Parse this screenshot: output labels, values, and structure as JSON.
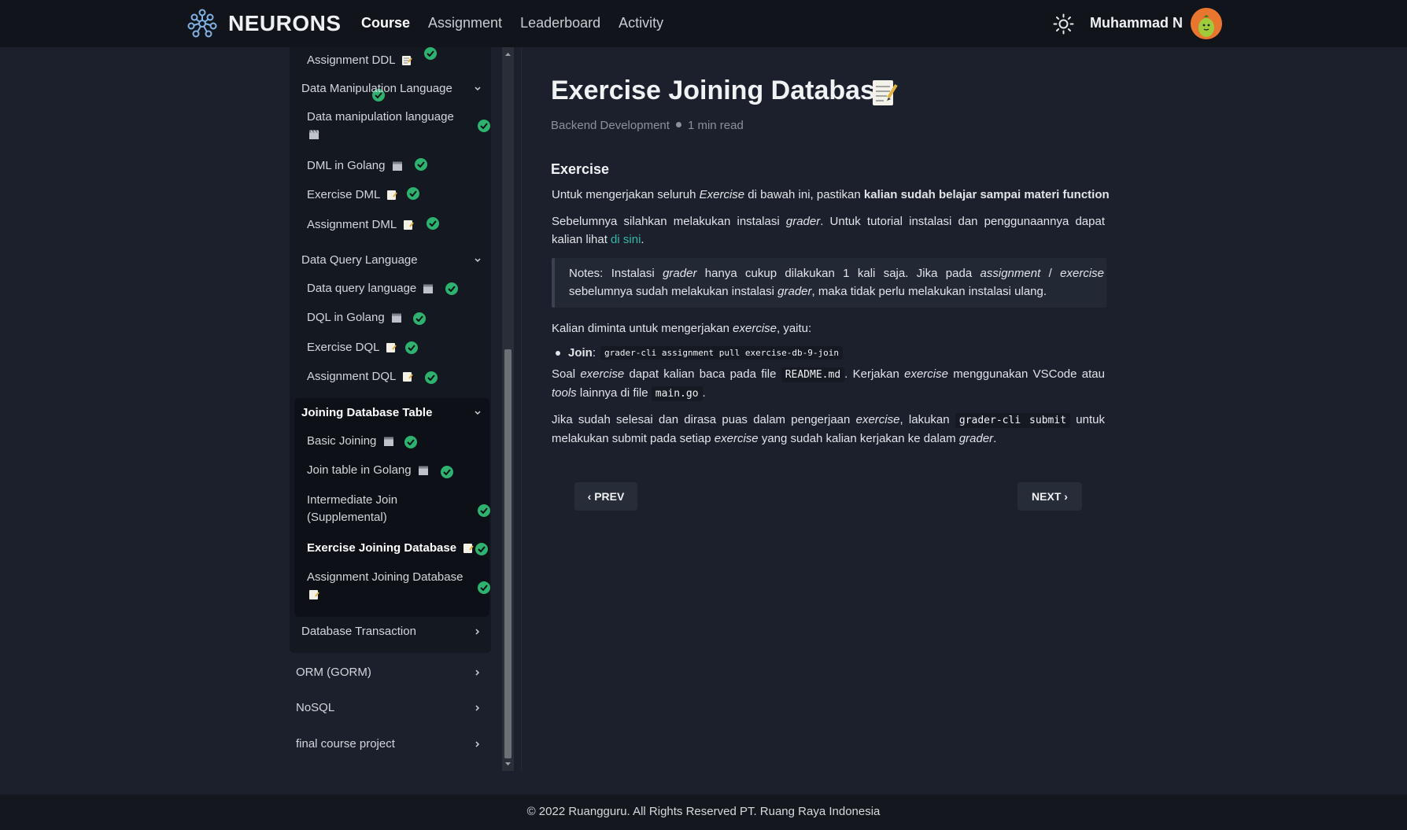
{
  "header": {
    "brand": "NEURONS",
    "nav": [
      "Course",
      "Assignment",
      "Leaderboard",
      "Activity"
    ],
    "active_nav": "Course",
    "username": "Muhammad N"
  },
  "sidebar": {
    "top_item": "Assignment DDL",
    "dml_head": "Data Manipulation Language",
    "dml_items": [
      "Data manipulation language",
      "DML in Golang",
      "Exercise DML",
      "Assignment DML"
    ],
    "dql_head": "Data Query Language",
    "dql_items": [
      "Data query language",
      "DQL in Golang",
      "Exercise DQL",
      "Assignment DQL"
    ],
    "join_head": "Joining Database Table",
    "join_items": [
      "Basic Joining",
      "Join table in Golang",
      "Intermediate Join (Supplemental)",
      "Exercise Joining Database",
      "Assignment Joining Database"
    ],
    "trans_head": "Database Transaction",
    "sections": [
      "ORM (GORM)",
      "NoSQL",
      "final course project"
    ]
  },
  "article": {
    "title": "Exercise Joining Database",
    "category": "Backend Development",
    "read_time": "1 min read",
    "heading": "Exercise",
    "p1_a": "Untuk mengerjakan seluruh ",
    "p1_em": "Exercise",
    "p1_b": " di bawah ini, pastikan ",
    "p1_strong": "kalian sudah belajar sampai materi function",
    "p2_a": "Sebelumnya silahkan melakukan instalasi ",
    "p2_em": "grader",
    "p2_b": ". Untuk tutorial instalasi dan penggunaannya dapat kalian lihat ",
    "p2_link": "di sini",
    "p2_c": ".",
    "note_a": "Notes: Instalasi ",
    "note_em1": "grader",
    "note_b": " hanya cukup dilakukan 1 kali saja. Jika pada ",
    "note_em2": "assignment",
    "note_c": " / ",
    "note_em3": "exercise",
    "note_d": " sebelumnya sudah melakukan instalasi ",
    "note_em4": "grader",
    "note_e": ", maka tidak perlu melakukan instalasi ulang.",
    "p3_a": "Kalian diminta untuk mengerjakan ",
    "p3_em": "exercise",
    "p3_b": ", yaitu:",
    "bullet_label": "Join",
    "bullet_colon": ":",
    "bullet_code": "grader-cli assignment pull exercise-db-9-join",
    "p4_a": "Soal ",
    "p4_em1": "exercise",
    "p4_b": " dapat kalian baca pada file ",
    "p4_code1": "README.md",
    "p4_c": ". Kerjakan ",
    "p4_em2": "exercise",
    "p4_d": " menggunakan VSCode atau ",
    "p4_em3": "tools",
    "p4_e": " lainnya di file ",
    "p4_code2": "main.go",
    "p4_f": ".",
    "p5_a": "Jika sudah selesai dan dirasa puas dalam pengerjaan ",
    "p5_em1": "exercise",
    "p5_b": ", lakukan ",
    "p5_code": "grader-cli submit",
    "p5_c": " untuk melakukan submit pada setiap ",
    "p5_em2": "exercise",
    "p5_d": " yang sudah kalian kerjakan ke dalam ",
    "p5_em3": "grader",
    "p5_e": ".",
    "prev": "‹ PREV",
    "next": "NEXT ›"
  },
  "footer": {
    "text": "© 2022 Ruangguru. All Rights Reserved PT. Ruang Raya Indonesia"
  },
  "colors": {
    "background": "#1b202c",
    "topbar": "#11141b",
    "check": "#2db36f",
    "link": "#35b8a8"
  },
  "icons": [
    "neurons-logo-icon",
    "sun-icon",
    "avatar",
    "memo-icon",
    "video-icon",
    "check-icon",
    "chevron-down-icon",
    "chevron-right-icon"
  ]
}
